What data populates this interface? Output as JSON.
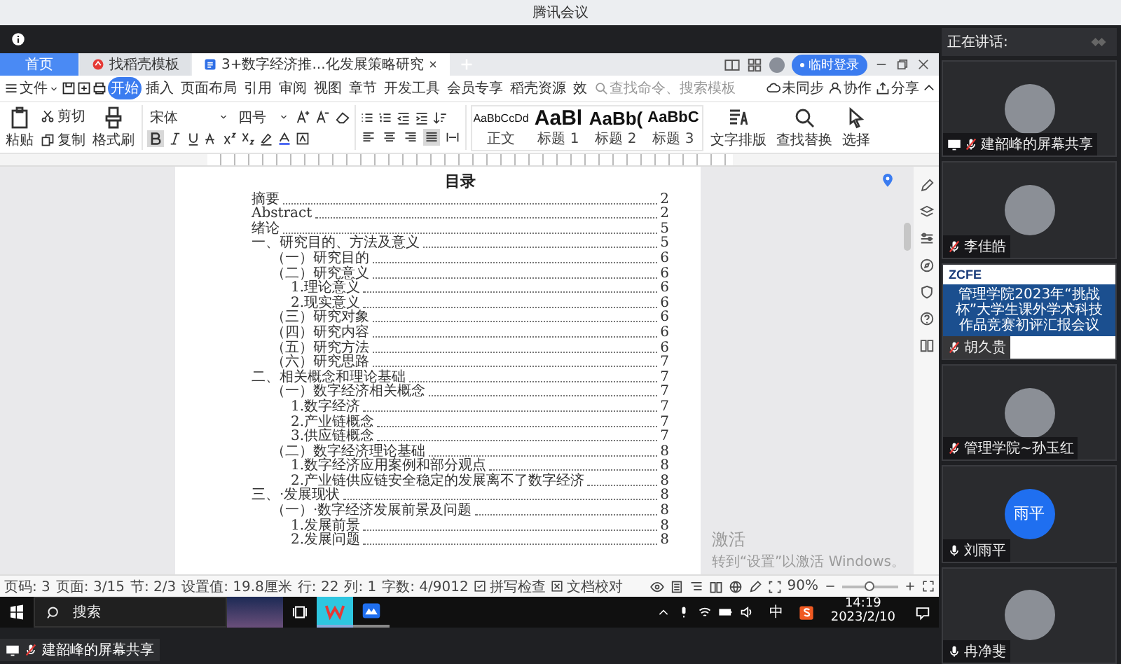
{
  "meeting": {
    "title": "腾讯会议",
    "share_label": "建韶峰的屏幕共享"
  },
  "wps": {
    "tabs": [
      {
        "label": "首页",
        "kind": "home",
        "selected": false
      },
      {
        "label": "找稻壳模板",
        "kind": "template",
        "selected": false
      },
      {
        "label": "3+数字经济推...化发展策略研究",
        "kind": "doc",
        "selected": true
      }
    ],
    "login": "临时登录",
    "menu": {
      "file": "文件",
      "search_placeholder": "查找命令、搜索模板",
      "sync": "未同步",
      "collab": "协作",
      "share": "分享",
      "tabs": [
        {
          "label": "开始",
          "selected": true
        },
        {
          "label": "插入",
          "selected": false
        },
        {
          "label": "页面布局",
          "selected": false
        },
        {
          "label": "引用",
          "selected": false
        },
        {
          "label": "审阅",
          "selected": false
        },
        {
          "label": "视图",
          "selected": false
        },
        {
          "label": "章节",
          "selected": false
        },
        {
          "label": "开发工具",
          "selected": false
        },
        {
          "label": "会员专享",
          "selected": false
        },
        {
          "label": "稻壳资源",
          "selected": false
        },
        {
          "label": "效",
          "selected": false
        }
      ]
    },
    "ribbon": {
      "paste": "粘贴",
      "cut": "剪切",
      "copy": "复制",
      "format_painter": "格式刷",
      "font": "宋体",
      "size": "四号",
      "bold_selected": true,
      "align": [
        {
          "kind": "left",
          "selected": false
        },
        {
          "kind": "center",
          "selected": false
        },
        {
          "kind": "right",
          "selected": false
        },
        {
          "kind": "justify",
          "selected": true
        },
        {
          "kind": "distributed",
          "selected": false
        }
      ],
      "styles": [
        {
          "preview": "AaBbCcDd",
          "label": "正文",
          "kind": "body"
        },
        {
          "preview": "AaBl",
          "label": "标题 1",
          "kind": "h1"
        },
        {
          "preview": "AaBb(",
          "label": "标题 2",
          "kind": "h2"
        },
        {
          "preview": "AaBbC",
          "label": "标题 3",
          "kind": "h3"
        }
      ],
      "tools": [
        {
          "label": "文字排版",
          "kind": "layout"
        },
        {
          "label": "查找替换",
          "kind": "find"
        },
        {
          "label": "选择",
          "kind": "select"
        }
      ]
    },
    "document": {
      "title": "目录",
      "toc": [
        {
          "text": "摘要",
          "page": "2"
        },
        {
          "text": "Abstract",
          "page": "2"
        },
        {
          "text": "绪论",
          "page": "5"
        },
        {
          "text": "一、研究目的、方法及意义",
          "page": "5",
          "children": [
            {
              "text": "（一）研究目的",
              "page": "6"
            },
            {
              "text": "（二）研究意义",
              "page": "6",
              "children": [
                {
                  "text": "1.理论意义",
                  "page": "6"
                },
                {
                  "text": "2.现实意义",
                  "page": "6"
                }
              ]
            },
            {
              "text": "（三）研究对象",
              "page": "6"
            },
            {
              "text": "（四）研究内容",
              "page": "6"
            },
            {
              "text": "（五）研究方法",
              "page": "6"
            },
            {
              "text": "（六）研究思路",
              "page": "7"
            }
          ]
        },
        {
          "text": "二、相关概念和理论基础",
          "page": "7",
          "children": [
            {
              "text": "（一）数字经济相关概念",
              "page": "7",
              "children": [
                {
                  "text": "1.数字经济",
                  "page": "7"
                },
                {
                  "text": "2.产业链概念",
                  "page": "7"
                },
                {
                  "text": "3.供应链概念",
                  "page": "7"
                }
              ]
            },
            {
              "text": "（二）数字经济理论基础",
              "page": "8",
              "children": [
                {
                  "text": "1.数字经济应用案例和部分观点",
                  "page": "8"
                },
                {
                  "text": "2.产业链供应链安全稳定的发展离不了数字经济",
                  "page": "8"
                }
              ]
            }
          ]
        },
        {
          "text": "三、·发展现状",
          "page": "8",
          "children": [
            {
              "text": "（一）·数字经济发展前景及问题",
              "page": "8",
              "children": [
                {
                  "text": "1.发展前景",
                  "page": "8"
                },
                {
                  "text": "2.发展问题",
                  "page": "8"
                }
              ]
            }
          ]
        }
      ]
    },
    "activation": {
      "title": "激活",
      "hint": "转到“设置”以激活 Windows。"
    },
    "status_bar": {
      "items": [
        "页码: 3",
        "页面: 3/15",
        "节: 2/3",
        "设置值: 19.8厘米",
        "行: 22",
        "列: 1",
        "字数: 4/9012"
      ],
      "spell_check": "拼写检查",
      "proofread": "文档校对",
      "zoom": "90%",
      "zoom_slider": {
        "level": 0.5
      }
    }
  },
  "taskbar": {
    "search": "搜索",
    "ime": "中",
    "time": "14:19",
    "date": "2023/2/10",
    "apps": [
      {
        "kind": "wps",
        "selected": true
      },
      {
        "kind": "meeting",
        "selected": false
      }
    ]
  },
  "participants": {
    "speaking_label": "正在讲话:",
    "tiles": [
      {
        "name": "建韶峰的屏幕共享",
        "kind": "photo",
        "sharing": true,
        "muted": true
      },
      {
        "name": "李佳皓",
        "kind": "photo",
        "sharing": false,
        "muted": true
      },
      {
        "name": "胡久贵",
        "kind": "slide",
        "sharing": false,
        "muted": true,
        "slide": {
          "logo": "ZCFE",
          "title": "管理学院2023年“挑战杯”大学生课外学术科技作品竞赛初评汇报会议"
        }
      },
      {
        "name": "管理学院~孙玉红",
        "kind": "photo",
        "sharing": false,
        "muted": true
      },
      {
        "name": "刘雨平",
        "kind": "initials",
        "initials": "雨平",
        "sharing": false,
        "muted": false
      },
      {
        "name": "冉净斐",
        "kind": "photo",
        "sharing": false,
        "muted": false
      }
    ]
  }
}
